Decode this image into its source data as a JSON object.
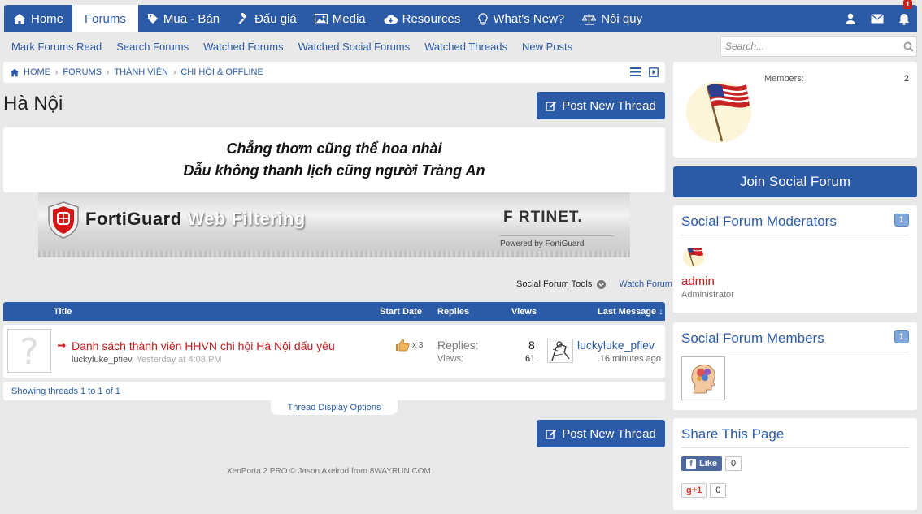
{
  "nav": {
    "items": [
      {
        "label": "Home",
        "icon": "home-icon"
      },
      {
        "label": "Forums",
        "icon": ""
      },
      {
        "label": "Mua - Bán",
        "icon": "tag-icon"
      },
      {
        "label": "Đấu giá",
        "icon": "gavel-icon"
      },
      {
        "label": "Media",
        "icon": "image-icon"
      },
      {
        "label": "Resources",
        "icon": "cloud-download-icon"
      },
      {
        "label": "What's New?",
        "icon": "lightbulb-icon"
      },
      {
        "label": "Nội quy",
        "icon": "scale-icon"
      }
    ],
    "alerts_count": "1"
  },
  "subnav": {
    "items": [
      "Mark Forums Read",
      "Search Forums",
      "Watched Forums",
      "Watched Social Forums",
      "Watched Threads",
      "New Posts"
    ],
    "search_placeholder": "Search..."
  },
  "breadcrumb": [
    "HOME",
    "FORUMS",
    "THÀNH VIÊN",
    "CHI HỘI & OFFLINE"
  ],
  "page": {
    "title": "Hà Nội",
    "post_new_thread": "Post New Thread",
    "quote_line1": "Chẳng thơm cũng thể hoa nhài",
    "quote_line2": "Dẫu không thanh lịch cũng người Tràng An"
  },
  "banner": {
    "forti": "FortiGuard",
    "web_filtering": "Web Filtering",
    "brand": "F RTINET.",
    "powered": "Powered by FortiGuard"
  },
  "tools": {
    "social_forum_tools": "Social Forum Tools",
    "watch_forum": "Watch Forum"
  },
  "thread_header": {
    "title": "Title",
    "start_date": "Start Date",
    "replies": "Replies",
    "views": "Views",
    "last_message": "Last Message ↓"
  },
  "thread": {
    "title": "Danh sách thành viên HHVN chi hội Hà Nội dấu yêu",
    "author": "luckyluke_pfiev",
    "date": "Yesterday at 4:08 PM",
    "likes": "x 3",
    "replies_label": "Replies:",
    "replies": "8",
    "views_label": "Views:",
    "views": "61",
    "last_user": "luckyluke_pfiev",
    "last_time": "16 minutes ago"
  },
  "showing": "Showing threads 1 to 1 of 1",
  "thread_display_options": "Thread Display Options",
  "footer": "XenPorta 2 PRO © Jason Axelrod from 8WAYRUN.COM",
  "sidebar": {
    "members_label": "Members:",
    "members_value": "2",
    "join": "Join Social Forum",
    "moderators_title": "Social Forum Moderators",
    "moderators_count": "1",
    "mod_name": "admin",
    "mod_role": "Administrator",
    "members_title": "Social Forum Members",
    "members_count": "1",
    "share_title": "Share This Page",
    "fb_like": "Like",
    "fb_count": "0",
    "gplus": "g+1",
    "gplus_count": "0"
  },
  "colors": {
    "primary": "#2b5aa6",
    "link_red": "#c41c1c",
    "background": "#e9e9e9"
  }
}
